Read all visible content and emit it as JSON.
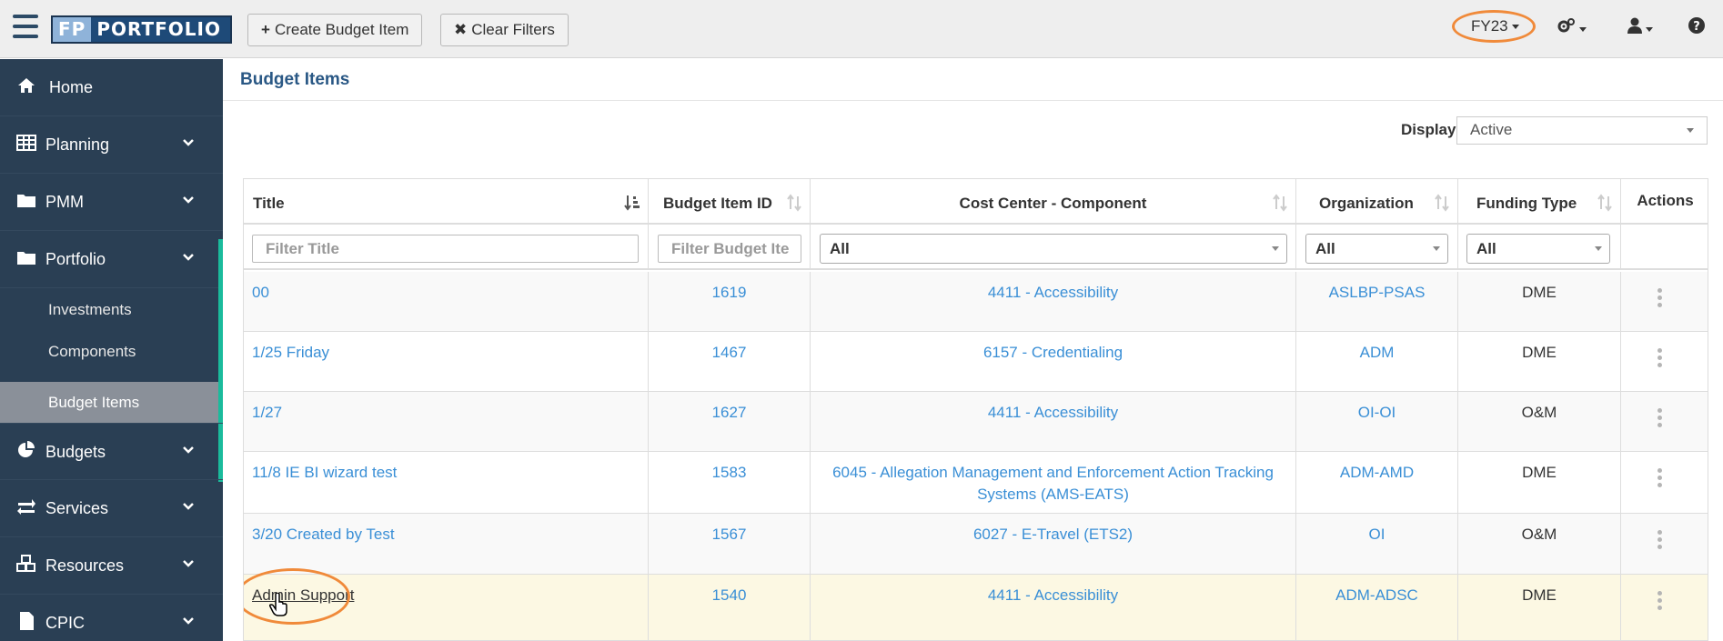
{
  "topbar": {
    "logo_text": "FP PORTFOLIO",
    "create_button": "Create Budget Item",
    "clear_button": "Clear Filters",
    "fiscal_year": "FY23"
  },
  "sidebar": {
    "items": [
      {
        "label": "Home",
        "icon": "home-icon"
      },
      {
        "label": "Planning",
        "icon": "table-icon"
      },
      {
        "label": "PMM",
        "icon": "folder-icon"
      },
      {
        "label": "Portfolio",
        "icon": "folder-icon"
      },
      {
        "label": "Budgets",
        "icon": "pie-chart-icon"
      },
      {
        "label": "Services",
        "icon": "exchange-icon"
      },
      {
        "label": "Resources",
        "icon": "cubes-icon"
      },
      {
        "label": "CPIC",
        "icon": "file-icon"
      }
    ],
    "portfolio_sub": [
      "Investments",
      "Components",
      "Budget Items"
    ]
  },
  "page": {
    "title": "Budget Items",
    "display_label": "Display",
    "display_value": "Active"
  },
  "table": {
    "columns": [
      "Title",
      "Budget Item ID",
      "Cost Center - Component",
      "Organization",
      "Funding Type",
      "Actions"
    ],
    "filters": {
      "title_placeholder": "Filter Title",
      "id_placeholder": "Filter Budget Ite",
      "cost_center": "All",
      "organization": "All",
      "funding_type": "All"
    },
    "rows": [
      {
        "title": "00",
        "id": "1619",
        "cost_center": "4411 - Accessibility",
        "org": "ASLBP-PSAS",
        "funding": "DME"
      },
      {
        "title": "1/25 Friday",
        "id": "1467",
        "cost_center": "6157 - Credentialing",
        "org": "ADM",
        "funding": "DME"
      },
      {
        "title": "1/27",
        "id": "1627",
        "cost_center": "4411 - Accessibility",
        "org": "OI-OI",
        "funding": "O&M"
      },
      {
        "title": "11/8 IE BI wizard test",
        "id": "1583",
        "cost_center": "6045 - Allegation Management and Enforcement Action Tracking Systems (AMS-EATS)",
        "org": "ADM-AMD",
        "funding": "DME"
      },
      {
        "title": "3/20 Created by Test",
        "id": "1567",
        "cost_center": "6027 - E-Travel (ETS2)",
        "org": "OI",
        "funding": "O&M"
      },
      {
        "title": "Admin Support",
        "id": "1540",
        "cost_center": "4411 - Accessibility",
        "org": "ADM-ADSC",
        "funding": "DME"
      }
    ]
  },
  "colors": {
    "sidebar_bg": "#2a3f54",
    "active_accent": "#1abb9c",
    "link": "#3a8fd6",
    "highlight_ring": "#f08a3a",
    "hover_row": "#fcf8e3"
  }
}
